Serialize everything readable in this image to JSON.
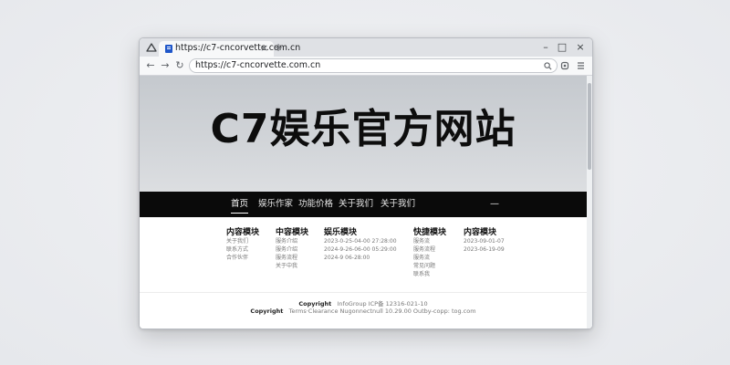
{
  "browser": {
    "tab": {
      "title": "https://c7-cncorvette.com.cn",
      "close": "×"
    },
    "new_tab": "+",
    "window_controls": {
      "minimize": "–",
      "maximize": "□",
      "close": "×"
    },
    "nav": {
      "back": "←",
      "forward": "→",
      "reload": "↻"
    },
    "address": "https://c7-cncorvette.com.cn",
    "icons": {
      "app": "triangle-logo-icon",
      "favicon": "page-favicon-icon",
      "search": "search-icon",
      "extension": "extension-icon",
      "menu": "menu-icon"
    }
  },
  "page": {
    "hero_title": "C7娱乐官方网站",
    "navbar": {
      "items": [
        {
          "label": "首页",
          "active": true
        },
        {
          "label": "娱乐作家",
          "active": false
        },
        {
          "label": "功能价格",
          "active": false
        },
        {
          "label": "关于我们",
          "active": false
        },
        {
          "label": "关于我们",
          "active": false
        }
      ],
      "dash": "—"
    },
    "columns": [
      {
        "title": "内容模块",
        "items": [
          "关于我们",
          "联系方式",
          "合作伙伴"
        ]
      },
      {
        "title": "中容模块",
        "items": [
          "服务介绍",
          "服务介绍",
          "服务流程",
          "关于中我"
        ]
      },
      {
        "title": "娱乐模块",
        "items": [
          "2023-0-25-04-00 27:28:00",
          "2024-9-26-06-00 05:29:00",
          "2024-9 06-28:00"
        ]
      },
      {
        "title": "快捷模块",
        "items": [
          "服务流",
          "服务流程",
          "服务流",
          "常见问题",
          "联系我"
        ]
      },
      {
        "title": "内容模块",
        "items": [
          "2023-09-01-07",
          "2023-06-19-09"
        ]
      }
    ],
    "footer": {
      "line1_strong": "Copyright",
      "line1_rest": "InfoGroup ICP备 12316-021-10",
      "line2_strong": "Copyright",
      "line2_rest": "Terms·Clearance   Nugonnectnull 10.29.00   Outby-copp: tog.com"
    }
  },
  "colors": {
    "navbar_bg": "#0a0a0a",
    "hero_bg": "#c9cdd2",
    "favicon": "#1f56c9"
  }
}
